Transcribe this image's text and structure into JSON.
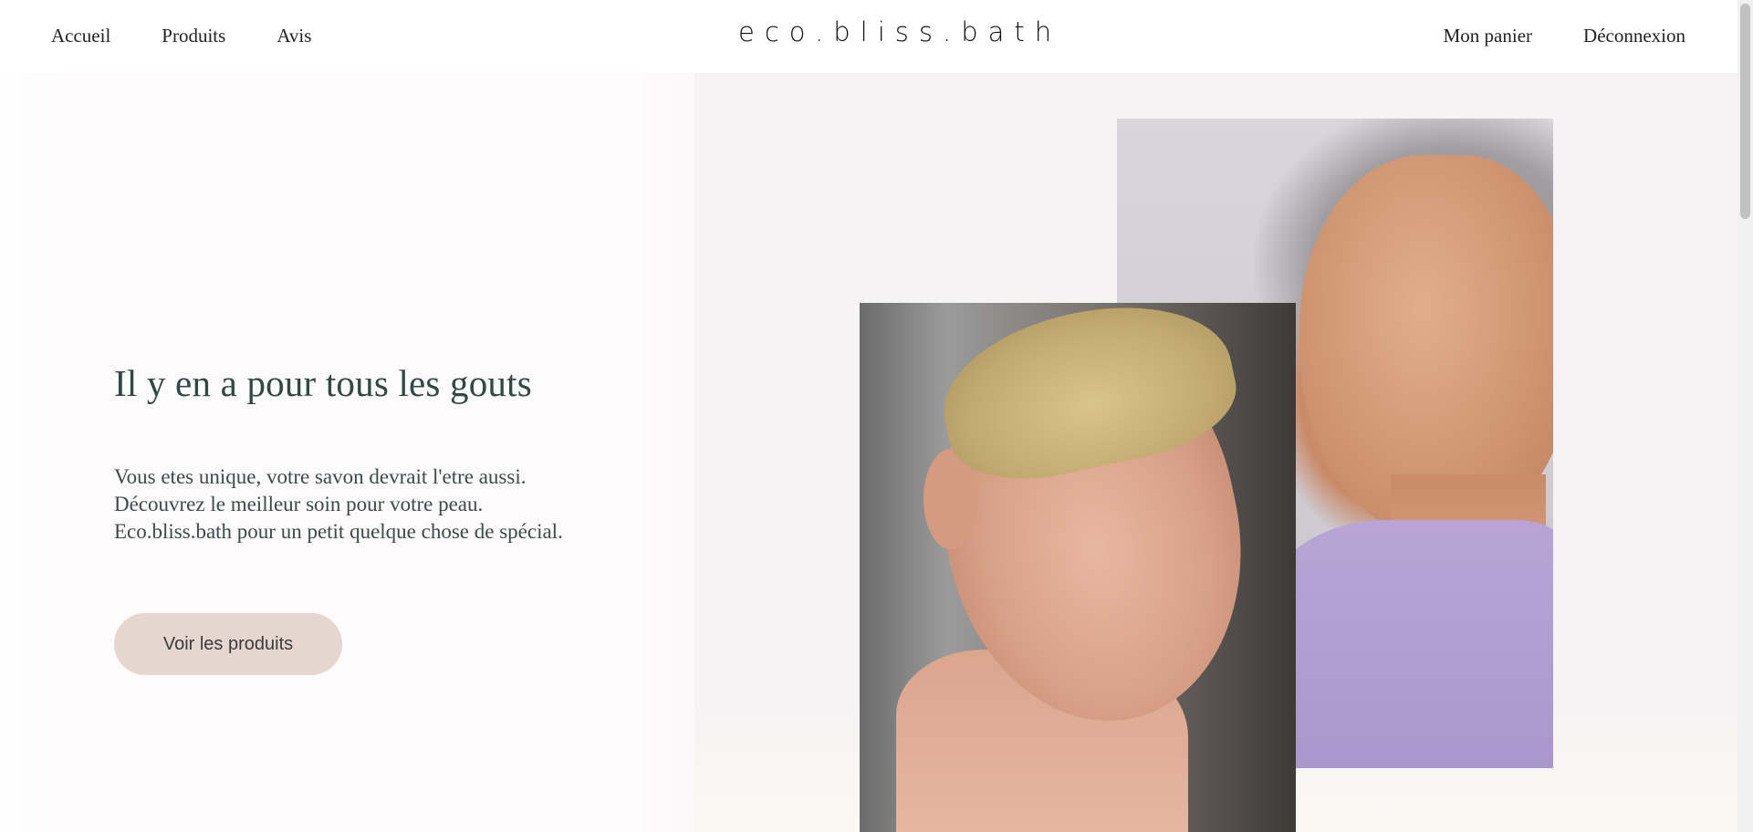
{
  "header": {
    "nav_left": [
      {
        "label": "Accueil"
      },
      {
        "label": "Produits"
      },
      {
        "label": "Avis"
      }
    ],
    "logo": "eco.bliss.bath",
    "nav_right": [
      {
        "label": "Mon panier"
      },
      {
        "label": "Déconnexion"
      }
    ]
  },
  "hero": {
    "title": "Il y en a pour tous les gouts",
    "text_lines": [
      "Vous etes unique, votre savon devrait l'etre aussi.",
      "Découvrez le meilleur soin pour votre peau.",
      "Eco.bliss.bath pour un petit quelque chose de spécial."
    ],
    "cta_label": "Voir les produits"
  },
  "colors": {
    "cta_background": "#e6d6d0",
    "title_color": "#2f4a44",
    "right_panel_background": "#f6f3f5"
  }
}
